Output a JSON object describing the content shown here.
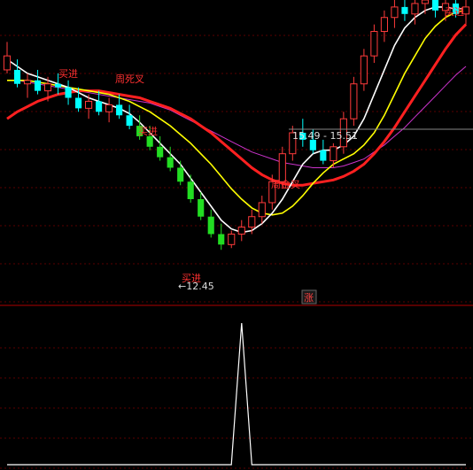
{
  "colors": {
    "background": "#000000",
    "up": "#ff3b3b",
    "down": "#00ffff",
    "alt_down": "#22dd22",
    "ma_short": "#ffffff",
    "ma_mid": "#ffff00",
    "ma_long": "#ff2020",
    "ma_xlong": "#cc33cc",
    "grid": "#5a0000",
    "price_line": "#888888",
    "signal": "#ffffff",
    "annotation": "#ff3030"
  },
  "chart_data": [
    {
      "type": "candlestick",
      "annotations": {
        "buy_1": "买进",
        "death_cross": "周死叉",
        "buy_2": "买进",
        "golden_cross": "周金叉",
        "buy_3": "买进",
        "buy_4": "买进",
        "low_label": "←12.45",
        "range_label": "15.49 - 15.51",
        "rise_badge": "涨"
      },
      "low_price": 12.45,
      "range_low": 15.49,
      "range_high": 15.51,
      "candles": [
        {
          "o": 18.0,
          "h": 18.4,
          "l": 17.5,
          "c": 17.6,
          "d": "up"
        },
        {
          "o": 17.6,
          "h": 17.9,
          "l": 17.1,
          "c": 17.2,
          "d": "down"
        },
        {
          "o": 17.2,
          "h": 17.5,
          "l": 16.8,
          "c": 17.3,
          "d": "up"
        },
        {
          "o": 17.3,
          "h": 17.6,
          "l": 16.9,
          "c": 17.0,
          "d": "down"
        },
        {
          "o": 17.0,
          "h": 17.4,
          "l": 16.7,
          "c": 17.2,
          "d": "up"
        },
        {
          "o": 17.2,
          "h": 17.5,
          "l": 16.9,
          "c": 17.1,
          "d": "down"
        },
        {
          "o": 17.1,
          "h": 17.3,
          "l": 16.6,
          "c": 16.8,
          "d": "down"
        },
        {
          "o": 16.8,
          "h": 17.1,
          "l": 16.4,
          "c": 16.5,
          "d": "down"
        },
        {
          "o": 16.5,
          "h": 16.9,
          "l": 16.2,
          "c": 16.7,
          "d": "up"
        },
        {
          "o": 16.7,
          "h": 17.0,
          "l": 16.3,
          "c": 16.4,
          "d": "down"
        },
        {
          "o": 16.4,
          "h": 16.8,
          "l": 16.1,
          "c": 16.6,
          "d": "up"
        },
        {
          "o": 16.6,
          "h": 16.9,
          "l": 16.2,
          "c": 16.3,
          "d": "down"
        },
        {
          "o": 16.3,
          "h": 16.6,
          "l": 15.9,
          "c": 16.0,
          "d": "down"
        },
        {
          "o": 16.0,
          "h": 16.3,
          "l": 15.6,
          "c": 15.7,
          "d": "down"
        },
        {
          "o": 15.7,
          "h": 16.0,
          "l": 15.3,
          "c": 15.4,
          "d": "down"
        },
        {
          "o": 15.4,
          "h": 15.7,
          "l": 15.0,
          "c": 15.1,
          "d": "down"
        },
        {
          "o": 15.1,
          "h": 15.4,
          "l": 14.7,
          "c": 14.8,
          "d": "down"
        },
        {
          "o": 14.8,
          "h": 15.0,
          "l": 14.3,
          "c": 14.4,
          "d": "down"
        },
        {
          "o": 14.4,
          "h": 14.6,
          "l": 13.8,
          "c": 13.9,
          "d": "down"
        },
        {
          "o": 13.9,
          "h": 14.1,
          "l": 13.3,
          "c": 13.4,
          "d": "down"
        },
        {
          "o": 13.4,
          "h": 13.6,
          "l": 12.8,
          "c": 12.9,
          "d": "down"
        },
        {
          "o": 12.9,
          "h": 13.2,
          "l": 12.45,
          "c": 12.6,
          "d": "down"
        },
        {
          "o": 12.6,
          "h": 13.0,
          "l": 12.5,
          "c": 12.9,
          "d": "up"
        },
        {
          "o": 12.9,
          "h": 13.3,
          "l": 12.7,
          "c": 13.1,
          "d": "up"
        },
        {
          "o": 13.1,
          "h": 13.6,
          "l": 12.9,
          "c": 13.4,
          "d": "up"
        },
        {
          "o": 13.4,
          "h": 14.0,
          "l": 13.2,
          "c": 13.8,
          "d": "up"
        },
        {
          "o": 13.8,
          "h": 14.6,
          "l": 13.6,
          "c": 14.4,
          "d": "up"
        },
        {
          "o": 14.4,
          "h": 15.4,
          "l": 14.2,
          "c": 15.2,
          "d": "up"
        },
        {
          "o": 15.2,
          "h": 16.0,
          "l": 15.0,
          "c": 15.8,
          "d": "up"
        },
        {
          "o": 15.8,
          "h": 16.2,
          "l": 15.4,
          "c": 15.6,
          "d": "down"
        },
        {
          "o": 15.6,
          "h": 15.9,
          "l": 15.2,
          "c": 15.3,
          "d": "down"
        },
        {
          "o": 15.3,
          "h": 15.6,
          "l": 14.9,
          "c": 15.0,
          "d": "down"
        },
        {
          "o": 15.0,
          "h": 15.5,
          "l": 14.8,
          "c": 15.4,
          "d": "up"
        },
        {
          "o": 15.4,
          "h": 16.4,
          "l": 15.2,
          "c": 16.2,
          "d": "up"
        },
        {
          "o": 16.2,
          "h": 17.4,
          "l": 16.0,
          "c": 17.2,
          "d": "up"
        },
        {
          "o": 17.2,
          "h": 18.2,
          "l": 17.0,
          "c": 18.0,
          "d": "up"
        },
        {
          "o": 18.0,
          "h": 18.9,
          "l": 17.8,
          "c": 18.7,
          "d": "up"
        },
        {
          "o": 18.7,
          "h": 19.3,
          "l": 18.4,
          "c": 19.1,
          "d": "up"
        },
        {
          "o": 19.1,
          "h": 19.6,
          "l": 18.8,
          "c": 19.4,
          "d": "up"
        },
        {
          "o": 19.4,
          "h": 19.8,
          "l": 19.0,
          "c": 19.2,
          "d": "down"
        },
        {
          "o": 19.2,
          "h": 19.7,
          "l": 18.9,
          "c": 19.5,
          "d": "up"
        },
        {
          "o": 19.5,
          "h": 19.9,
          "l": 19.2,
          "c": 19.6,
          "d": "up"
        },
        {
          "o": 19.6,
          "h": 19.9,
          "l": 19.1,
          "c": 19.3,
          "d": "down"
        },
        {
          "o": 19.3,
          "h": 19.7,
          "l": 19.0,
          "c": 19.5,
          "d": "up"
        },
        {
          "o": 19.5,
          "h": 19.8,
          "l": 19.1,
          "c": 19.2,
          "d": "down"
        },
        {
          "o": 19.2,
          "h": 19.6,
          "l": 18.9,
          "c": 19.4,
          "d": "up"
        }
      ],
      "ma_short": [
        17.9,
        17.7,
        17.5,
        17.4,
        17.3,
        17.2,
        17.1,
        16.95,
        16.8,
        16.7,
        16.6,
        16.5,
        16.35,
        16.1,
        15.8,
        15.5,
        15.2,
        14.9,
        14.5,
        14.1,
        13.7,
        13.3,
        13.05,
        12.95,
        13.0,
        13.2,
        13.5,
        13.9,
        14.4,
        14.9,
        15.2,
        15.3,
        15.3,
        15.45,
        15.7,
        16.2,
        16.9,
        17.6,
        18.3,
        18.8,
        19.1,
        19.3,
        19.4,
        19.4,
        19.35,
        19.35
      ],
      "ma_mid": [
        17.3,
        17.3,
        17.3,
        17.25,
        17.2,
        17.15,
        17.1,
        17.05,
        17.0,
        16.95,
        16.9,
        16.8,
        16.7,
        16.55,
        16.4,
        16.2,
        16.0,
        15.75,
        15.5,
        15.2,
        14.9,
        14.55,
        14.2,
        13.9,
        13.65,
        13.5,
        13.45,
        13.5,
        13.7,
        14.0,
        14.35,
        14.65,
        14.9,
        15.05,
        15.2,
        15.45,
        15.8,
        16.3,
        16.9,
        17.5,
        18.0,
        18.5,
        18.85,
        19.1,
        19.25,
        19.3
      ],
      "ma_long": [
        16.2,
        16.4,
        16.55,
        16.7,
        16.8,
        16.9,
        16.95,
        17.0,
        17.0,
        17.0,
        16.95,
        16.9,
        16.85,
        16.8,
        16.7,
        16.6,
        16.5,
        16.35,
        16.2,
        16.0,
        15.8,
        15.55,
        15.3,
        15.05,
        14.8,
        14.6,
        14.45,
        14.35,
        14.3,
        14.3,
        14.35,
        14.4,
        14.45,
        14.55,
        14.7,
        14.9,
        15.2,
        15.55,
        15.95,
        16.4,
        16.85,
        17.3,
        17.75,
        18.2,
        18.6,
        18.9
      ],
      "ma_xlong": [
        17.3,
        17.3,
        17.25,
        17.2,
        17.15,
        17.1,
        17.05,
        17.0,
        16.95,
        16.9,
        16.85,
        16.8,
        16.75,
        16.7,
        16.65,
        16.55,
        16.45,
        16.3,
        16.15,
        16.0,
        15.85,
        15.7,
        15.55,
        15.4,
        15.25,
        15.15,
        15.05,
        14.95,
        14.9,
        14.85,
        14.8,
        14.8,
        14.8,
        14.85,
        14.95,
        15.05,
        15.25,
        15.45,
        15.7,
        15.95,
        16.25,
        16.55,
        16.85,
        17.15,
        17.45,
        17.7
      ],
      "price_min": 12.0,
      "price_max": 19.6
    },
    {
      "type": "line",
      "series": [
        {
          "values": [
            0,
            0,
            0,
            0,
            0,
            0,
            0,
            0,
            0,
            0,
            0,
            0,
            0,
            0,
            0,
            0,
            0,
            0,
            0,
            0,
            0,
            0,
            0,
            1,
            0,
            0,
            0,
            0,
            0,
            0,
            0,
            0,
            0,
            0,
            0,
            0,
            0,
            0,
            0,
            0,
            0,
            0,
            0,
            0,
            0,
            0
          ]
        }
      ],
      "ylim": [
        0,
        1
      ]
    }
  ]
}
